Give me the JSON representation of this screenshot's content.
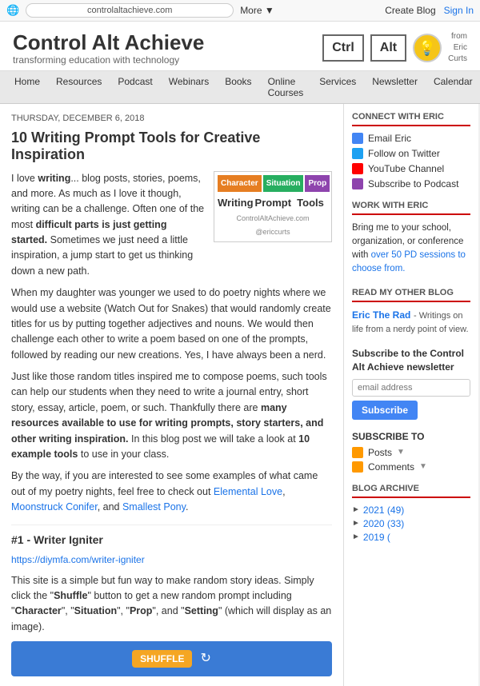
{
  "topbar": {
    "favicon": "🌐",
    "address": "controlaltachieve.com",
    "more_label": "More ▼",
    "create_blog": "Create Blog",
    "sign_in": "Sign In"
  },
  "header": {
    "site_title": "Control Alt Achieve",
    "site_tagline": "transforming education with technology",
    "logo_ctrl": "Ctrl",
    "logo_alt": "Alt",
    "logo_from": "from\nEric\nCurts"
  },
  "nav": {
    "items": [
      "Home",
      "Resources",
      "Podcast",
      "Webinars",
      "Books",
      "Online Courses",
      "Services",
      "Newsletter",
      "Calendar"
    ]
  },
  "post": {
    "date": "Thursday, December 6, 2018",
    "title": "10 Writing Prompt Tools for Creative Inspiration",
    "body_p1_pre": "I love ",
    "body_p1_bold": "writing",
    "body_p1_post": "... blog posts, stories, poems, and more. As much as I love it though, writing can be a challenge. Often one of the most",
    "body_p1_bold2": "difficult parts is just getting started.",
    "body_p1_end": "Sometimes we just need a little inspiration, a jump start to get us thinking down a new path.",
    "body_p2": "When my daughter was younger we used to do poetry nights where we would use a website (Watch Out for Snakes) that would randomly create titles for us by putting together adjectives and nouns. We would then challenge each other to write a poem based on one of the prompts, followed by reading our new creations. Yes, I have always been a nerd.",
    "body_p3_pre": "Just like those random titles inspired me to compose poems, such tools can help our students when they need to write a journal entry, short story, essay, article, poem, or such. Thankfully there are ",
    "body_p3_bold": "many resources available to use for writing prompts, story starters, and other writing inspiration.",
    "body_p3_end": "In this blog post we will take a look at",
    "body_p3_bold2": "10 example tools",
    "body_p3_end2": "to use in your class.",
    "body_p4": "By the way, if you are interested to see some examples of what came out of my poetry nights, feel free to check out Elemental Love, Moonstruck Conifer, and Smallest Pony.",
    "section1_title": "#1 - Writer Igniter",
    "section1_link": "https://diymfa.com/writer-igniter",
    "section1_body": "This site is a simple but fun way to make random story ideas. Simply click the \"Shuffle\" button to get a new random prompt including \"Character\", \"Situation\", \"Prop\", and \"Setting\" (which will display as an image).",
    "img_tabs": [
      "Character",
      "Situation",
      "Prop"
    ],
    "img_labels": [
      "Writing",
      "Prompt",
      "Tools"
    ],
    "img_credit1": "ControlAltAchieve.com",
    "img_credit2": "@ericcurts",
    "shuffle_label": "SHUFFLE"
  },
  "sidebar": {
    "connect_title": "CONNECT WITH ERIC",
    "email_label": "Email Eric",
    "twitter_label": "Follow on Twitter",
    "youtube_label": "YouTube Channel",
    "podcast_label": "Subscribe to Podcast",
    "work_title": "WORK WITH ERIC",
    "work_text": "Bring me to your school, organization, or conference with",
    "work_link_text": "over 50 PD sessions to choose from.",
    "blog_title": "READ MY OTHER BLOG",
    "blog_link": "Eric The Rad",
    "blog_desc": "- Writings on life from a nerdy point of view.",
    "newsletter_title": "Subscribe to the Control Alt Achieve newsletter",
    "email_placeholder": "email address",
    "subscribe_btn": "Subscribe",
    "subscribe_title": "SUBSCRIBE TO",
    "posts_label": "Posts",
    "comments_label": "Comments",
    "archive_title": "BLOG ARCHIVE",
    "archive_items": [
      {
        "year": "2021",
        "count": "(49)"
      },
      {
        "year": "2020",
        "count": "(33)"
      },
      {
        "year": "2019",
        "count": "("
      }
    ]
  }
}
